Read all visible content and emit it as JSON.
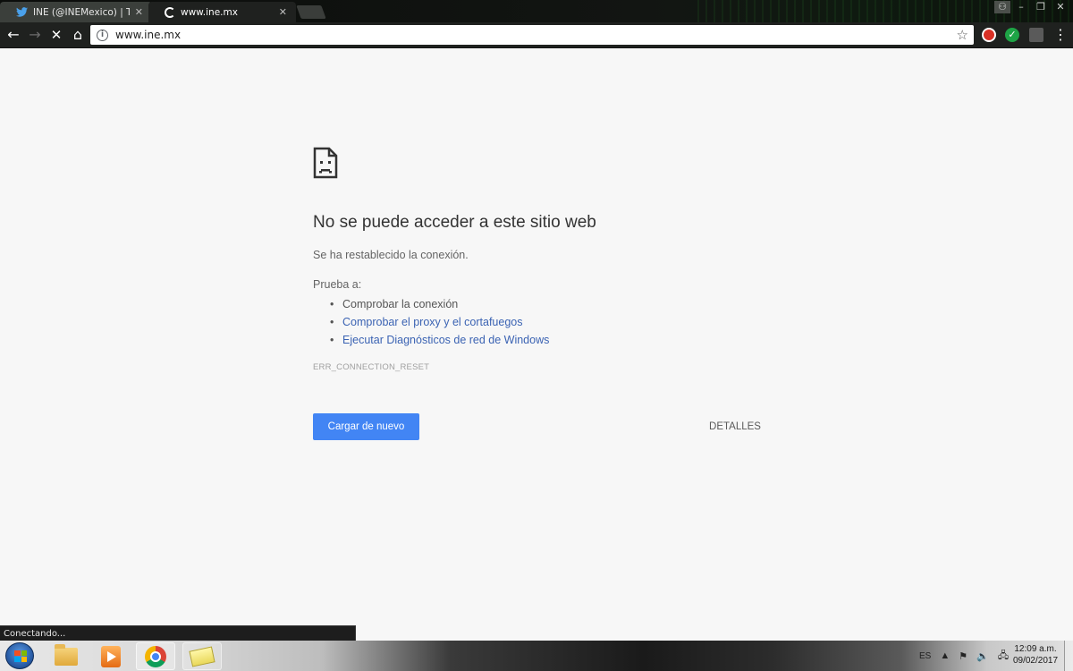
{
  "tabs": [
    {
      "title": "INE (@INEMexico) | Twitt",
      "icon": "twitter-icon",
      "close": "✕"
    },
    {
      "title": "www.ine.mx",
      "icon": "loading-spinner-icon",
      "close": "✕"
    }
  ],
  "toolbar": {
    "url": "www.ine.mx",
    "back": "←",
    "forward": "→",
    "stop": "✕",
    "home": "⌂",
    "star": "☆",
    "menu": "⋮",
    "info": "i",
    "ext_check": "✓"
  },
  "window_controls": {
    "minimize": "–",
    "restore": "❐",
    "close": "✕",
    "user": "👤"
  },
  "error_page": {
    "title": "No se puede acceder a este sitio web",
    "subtitle": "Se ha restablecido la conexión.",
    "try_label": "Prueba a:",
    "suggestions": [
      "Comprobar la conexión",
      "Comprobar el proxy y el cortafuegos",
      "Ejecutar Diagnósticos de red de Windows"
    ],
    "error_code": "ERR_CONNECTION_RESET",
    "reload_button": "Cargar de nuevo",
    "details_button": "DETALLES"
  },
  "status_bar": {
    "text": "Conectando..."
  },
  "taskbar": {
    "language": "ES",
    "time": "12:09 a.m.",
    "date": "09/02/2017",
    "tray_up_arrow": "▲",
    "tray_volume": "🔊"
  },
  "colors": {
    "accent_button": "#4285f4",
    "link": "#3b63b3",
    "page_background": "#f7f7f7"
  }
}
